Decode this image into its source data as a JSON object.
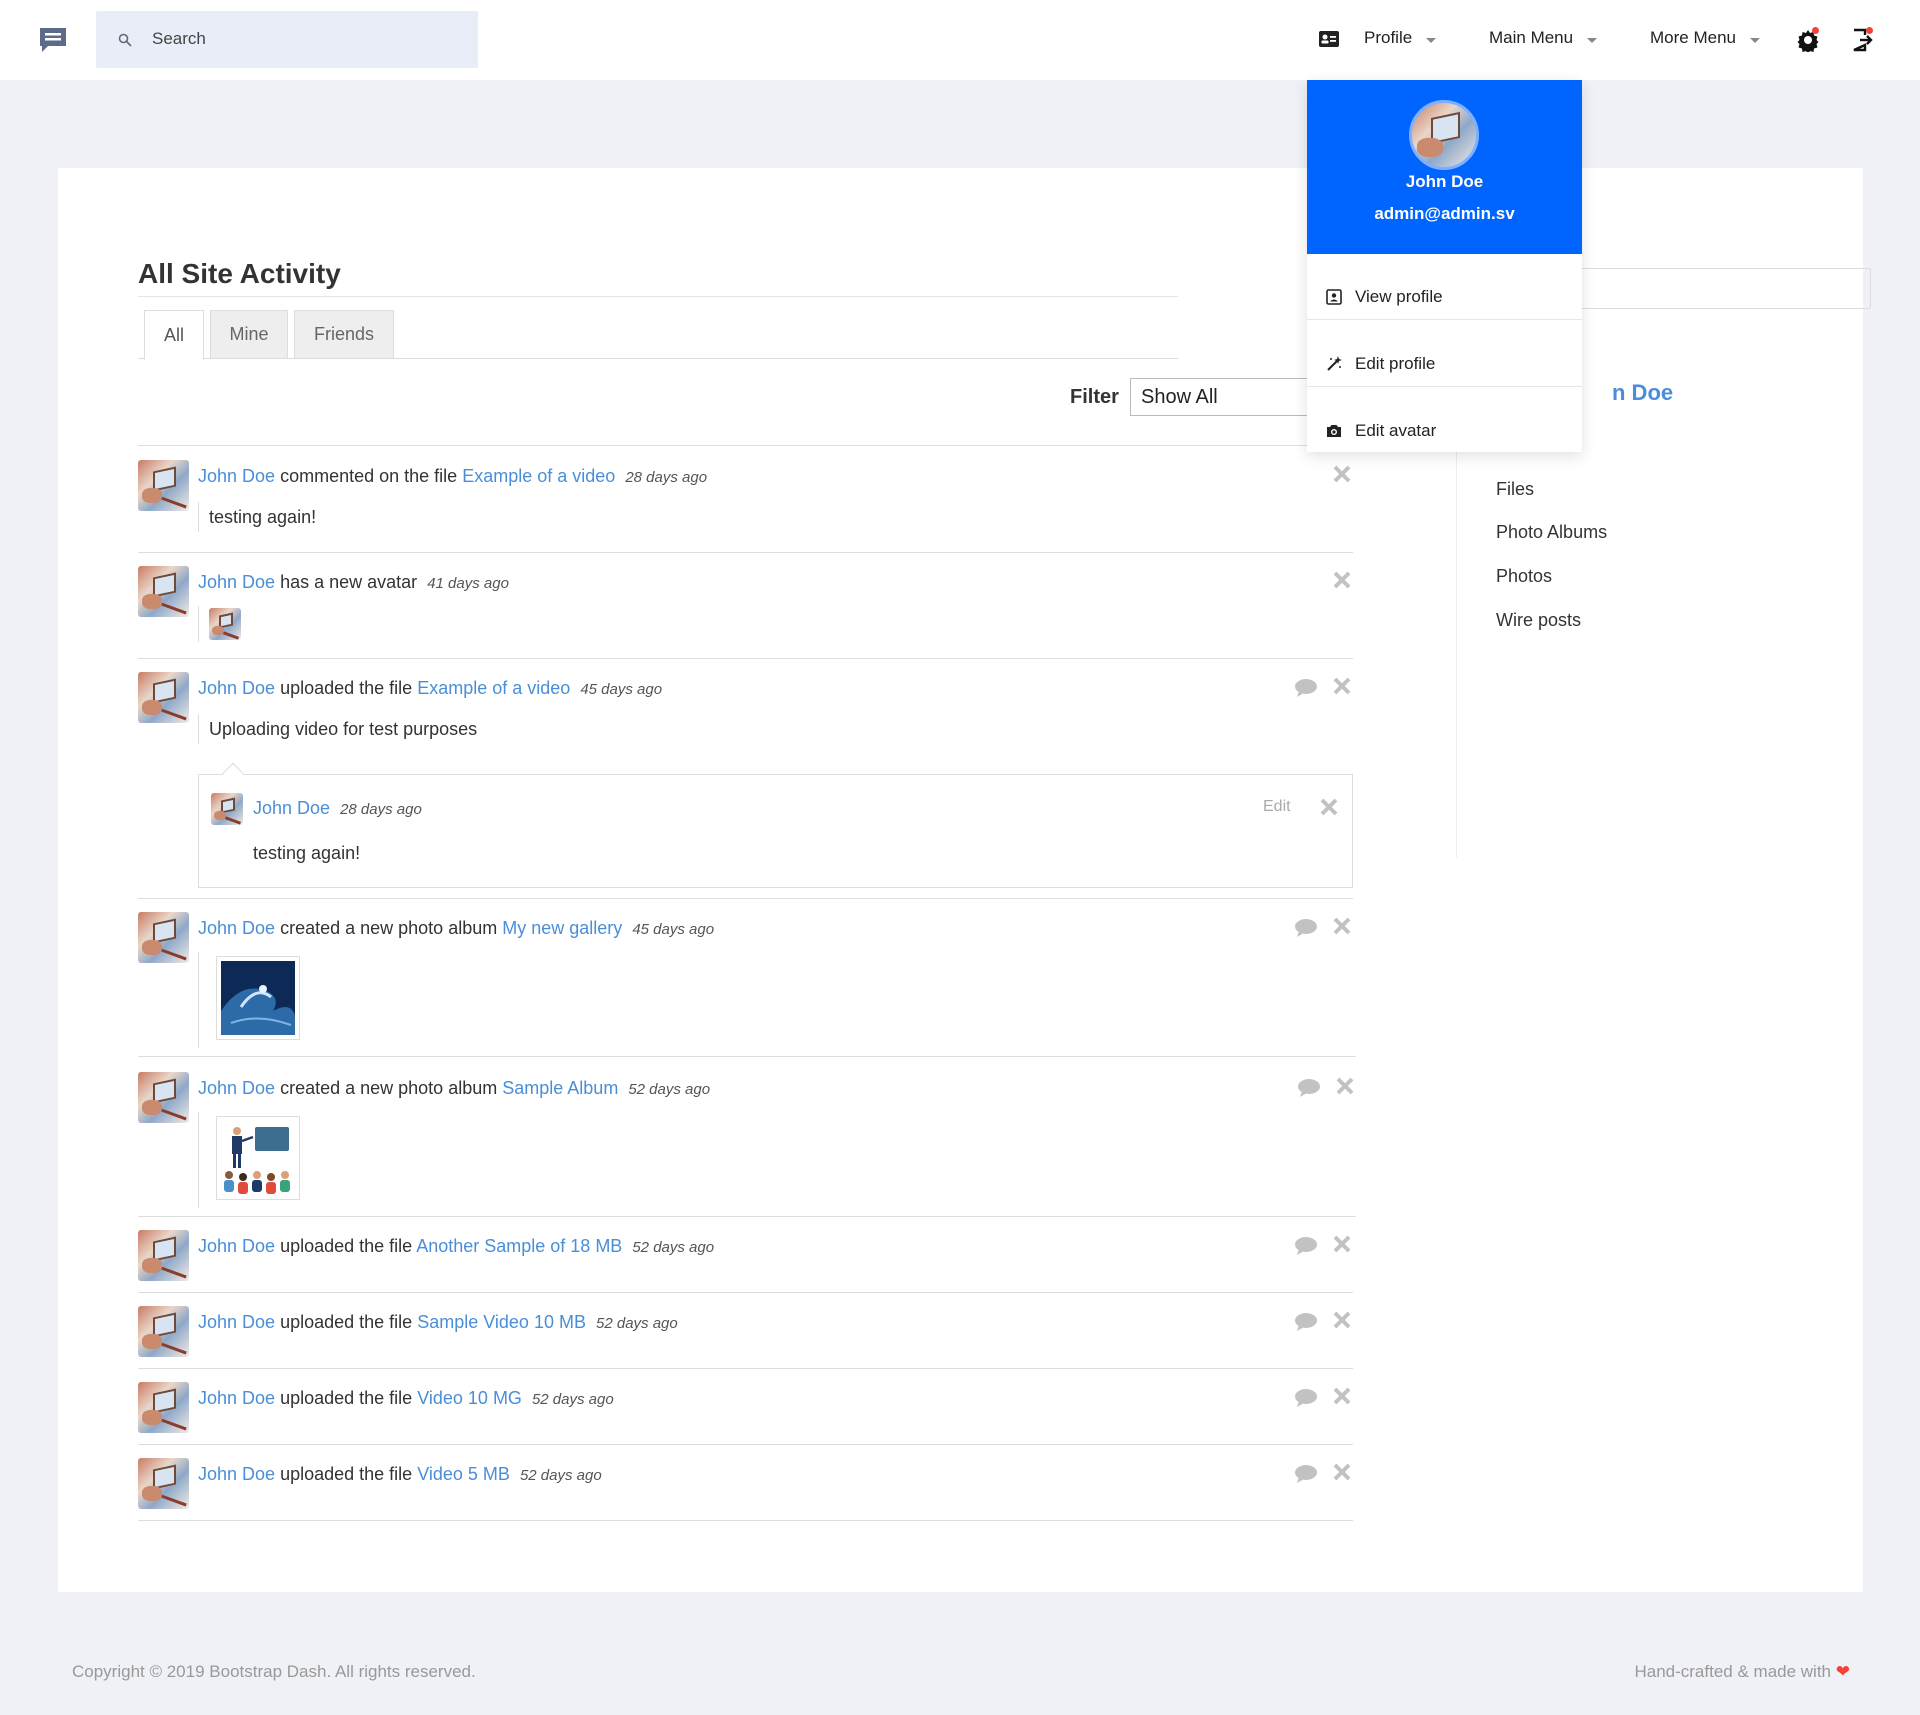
{
  "header": {
    "search_placeholder": "Search",
    "profile_label": "Profile",
    "main_menu_label": "Main Menu",
    "more_menu_label": "More Menu"
  },
  "page": {
    "title": "All Site Activity",
    "tabs": [
      "All",
      "Mine",
      "Friends"
    ],
    "filter_label": "Filter",
    "filter_value": "Show All"
  },
  "activities": [
    {
      "actor": "John Doe",
      "verb": "commented on the file",
      "object": "Example of a video",
      "time": "28 days ago",
      "body": "testing again!"
    },
    {
      "actor": "John Doe",
      "verb": "has a new avatar",
      "object": "",
      "time": "41 days ago"
    },
    {
      "actor": "John Doe",
      "verb": "uploaded the file",
      "object": "Example of a video",
      "time": "45 days ago",
      "body": "Uploading video for test purposes",
      "comment": {
        "author": "John Doe",
        "time": "28 days ago",
        "edit_label": "Edit",
        "text": "testing again!"
      }
    },
    {
      "actor": "John Doe",
      "verb": "created a new photo album",
      "object": "My new gallery",
      "time": "45 days ago"
    },
    {
      "actor": "John Doe",
      "verb": "created a new photo album",
      "object": "Sample Album",
      "time": "52 days ago"
    },
    {
      "actor": "John Doe",
      "verb": "uploaded the file",
      "object": "Another Sample of 18 MB",
      "time": "52 days ago"
    },
    {
      "actor": "John Doe",
      "verb": "uploaded the file",
      "object": "Sample Video 10 MB",
      "time": "52 days ago"
    },
    {
      "actor": "John Doe",
      "verb": "uploaded the file",
      "object": "Video 10 MG",
      "time": "52 days ago"
    },
    {
      "actor": "John Doe",
      "verb": "uploaded the file",
      "object": "Video 5 MB",
      "time": "52 days ago"
    }
  ],
  "sidebar": {
    "name_fragment": "n Doe",
    "items": [
      "Files",
      "Photo Albums",
      "Photos",
      "Wire posts"
    ]
  },
  "dropdown": {
    "name": "John Doe",
    "email": "admin@admin.sv",
    "items": [
      "View profile",
      "Edit profile",
      "Edit avatar"
    ]
  },
  "footer": {
    "copyright": "Copyright © 2019 Bootstrap Dash. All rights reserved.",
    "credit": "Hand-crafted & made with",
    "heart": "❤"
  },
  "colors": {
    "accent": "#0065fe",
    "link": "#4a8ed9",
    "page_bg": "#f0f1f6",
    "badge": "#f44336"
  }
}
